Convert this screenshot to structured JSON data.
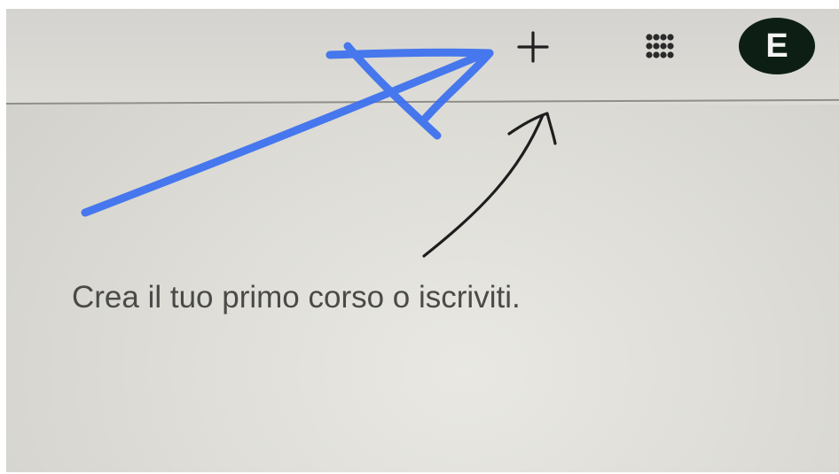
{
  "header": {
    "create_join_button": {
      "icon": "plus-icon",
      "label": "+"
    },
    "apps_button": {
      "icon": "apps-grid-icon"
    },
    "account": {
      "initial": "E",
      "color": "#0d1f14"
    }
  },
  "main": {
    "empty_message": "Crea il tuo primo corso o iscriviti."
  },
  "annotations": {
    "blue_arrow_color": "#3a6ff0",
    "black_arrow_color": "#1e1e1e"
  }
}
